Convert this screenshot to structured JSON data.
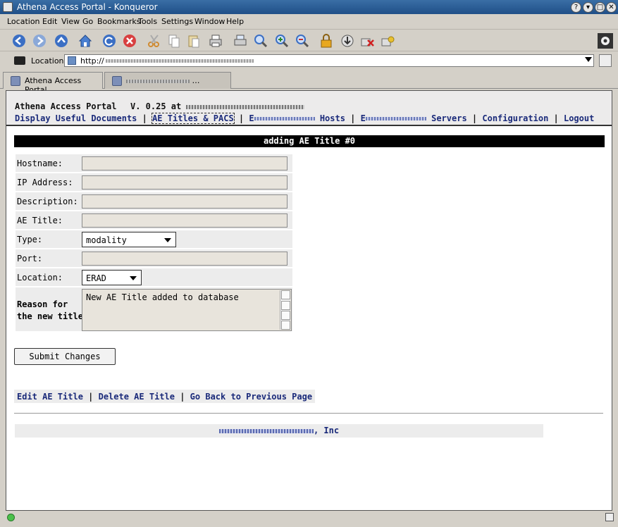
{
  "window": {
    "title": "Athena Access Portal - Konqueror",
    "buttons": [
      "?",
      "▾",
      "□",
      "✕"
    ]
  },
  "menu": {
    "items": [
      "Location",
      "Edit",
      "View",
      "Go",
      "Bookmarks",
      "Tools",
      "Settings",
      "Window",
      "Help"
    ]
  },
  "toolbar": {
    "icons": [
      "back-icon",
      "forward-icon",
      "up-icon",
      "home-icon",
      "reload-icon",
      "stop-icon",
      "cut-icon",
      "copy-icon",
      "paste-icon",
      "print-icon",
      "print-frame-icon",
      "zoom-icon",
      "zoom-in-icon",
      "zoom-out-icon",
      "lock-icon",
      "download-icon",
      "block-icon",
      "plugin-icon"
    ]
  },
  "location": {
    "label": "Location:",
    "url": "http://"
  },
  "tabs": [
    {
      "label": "Athena Access Portal",
      "active": true
    },
    {
      "label": "…",
      "active": false
    }
  ],
  "header": {
    "portal_name": "Athena Access Portal",
    "version": "V. 0.25 at",
    "nav": {
      "display_docs": "Display Useful Documents",
      "ae_titles": "AE Titles & PACS",
      "hosts_prefix": "E",
      "hosts": "Hosts",
      "servers_prefix": "E",
      "servers": "Servers",
      "configuration": "Configuration",
      "logout": "Logout"
    }
  },
  "section_title": "adding AE Title #0",
  "form": {
    "hostname_label": "Hostname:",
    "hostname_value": "",
    "ip_label": "IP Address:",
    "ip_value": "",
    "description_label": "Description:",
    "description_value": "",
    "ae_title_label": "AE Title:",
    "ae_title_value": "",
    "type_label": "Type:",
    "type_value": "modality",
    "port_label": "Port:",
    "port_value": "",
    "location_label": "Location:",
    "location_value": "ERAD",
    "reason_label_1": "Reason for",
    "reason_label_2": "the new title:",
    "reason_value": "New AE Title added to database",
    "submit_label": "Submit Changes"
  },
  "actions": {
    "edit": "Edit AE Title",
    "delete": "Delete AE Title",
    "back": "Go Back to Previous Page"
  },
  "footer": {
    "company_suffix": ", Inc"
  }
}
